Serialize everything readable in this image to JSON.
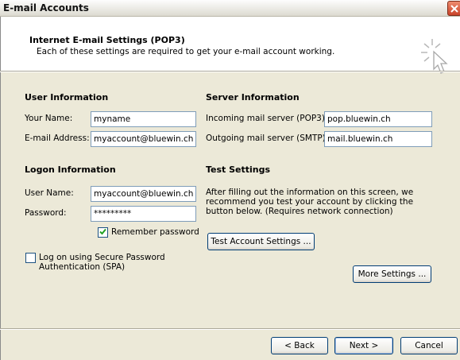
{
  "window": {
    "title": "E-mail Accounts"
  },
  "header": {
    "title": "Internet E-mail Settings (POP3)",
    "subtitle": "Each of these settings are required to get your e-mail account working."
  },
  "user_info": {
    "heading": "User Information",
    "name_label": "Your Name:",
    "name_value": "myname",
    "email_label": "E-mail Address:",
    "email_value": "myaccount@bluewin.ch"
  },
  "server_info": {
    "heading": "Server Information",
    "incoming_label": "Incoming mail server (POP3):",
    "incoming_value": "pop.bluewin.ch",
    "outgoing_label": "Outgoing mail server (SMTP):",
    "outgoing_value": "mail.bluewin.ch"
  },
  "logon_info": {
    "heading": "Logon Information",
    "username_label": "User Name:",
    "username_value": "myaccount@bluewin.ch",
    "password_label": "Password:",
    "password_value": "*********",
    "remember_label": "Remember password",
    "remember_checked": true,
    "spa_label_1": "Log on using Secure Password",
    "spa_label_2": "Authentication (SPA)",
    "spa_checked": false
  },
  "test_settings": {
    "heading": "Test Settings",
    "note_1": "After filling out the information on this screen, we",
    "note_2": "recommend you test your account by clicking the",
    "note_3": "button below. (Requires network connection)",
    "test_button": "Test Account Settings ..."
  },
  "more_settings_button": "More Settings ...",
  "footer": {
    "back": "< Back",
    "next": "Next >",
    "cancel": "Cancel"
  },
  "colors": {
    "dialog_bg": "#ece9d8",
    "field_border": "#7f9db9",
    "button_border": "#003c74",
    "close_button": "#c8432a",
    "checkmark": "#21a121"
  },
  "icons": [
    "close-icon",
    "wizard-sparkle-cursor-icon",
    "checkmark-icon"
  ]
}
